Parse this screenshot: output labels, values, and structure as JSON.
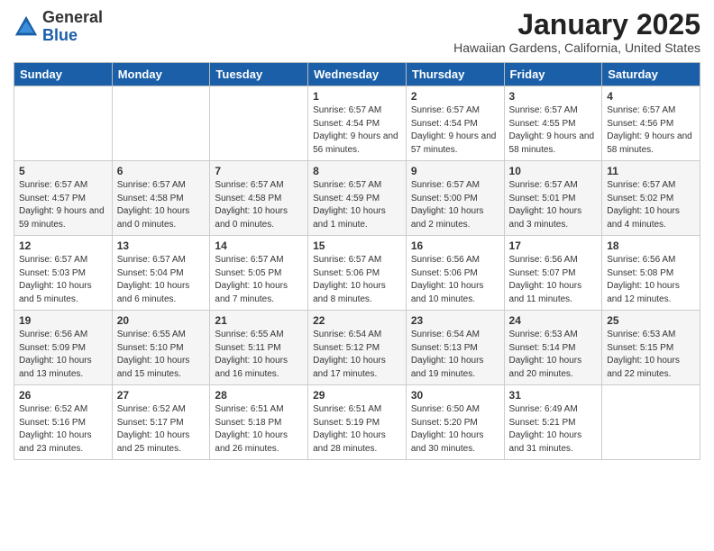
{
  "header": {
    "logo_general": "General",
    "logo_blue": "Blue",
    "title": "January 2025",
    "subtitle": "Hawaiian Gardens, California, United States"
  },
  "calendar": {
    "days_of_week": [
      "Sunday",
      "Monday",
      "Tuesday",
      "Wednesday",
      "Thursday",
      "Friday",
      "Saturday"
    ],
    "weeks": [
      [
        {
          "day": "",
          "info": ""
        },
        {
          "day": "",
          "info": ""
        },
        {
          "day": "",
          "info": ""
        },
        {
          "day": "1",
          "info": "Sunrise: 6:57 AM\nSunset: 4:54 PM\nDaylight: 9 hours and 56 minutes."
        },
        {
          "day": "2",
          "info": "Sunrise: 6:57 AM\nSunset: 4:54 PM\nDaylight: 9 hours and 57 minutes."
        },
        {
          "day": "3",
          "info": "Sunrise: 6:57 AM\nSunset: 4:55 PM\nDaylight: 9 hours and 58 minutes."
        },
        {
          "day": "4",
          "info": "Sunrise: 6:57 AM\nSunset: 4:56 PM\nDaylight: 9 hours and 58 minutes."
        }
      ],
      [
        {
          "day": "5",
          "info": "Sunrise: 6:57 AM\nSunset: 4:57 PM\nDaylight: 9 hours and 59 minutes."
        },
        {
          "day": "6",
          "info": "Sunrise: 6:57 AM\nSunset: 4:58 PM\nDaylight: 10 hours and 0 minutes."
        },
        {
          "day": "7",
          "info": "Sunrise: 6:57 AM\nSunset: 4:58 PM\nDaylight: 10 hours and 0 minutes."
        },
        {
          "day": "8",
          "info": "Sunrise: 6:57 AM\nSunset: 4:59 PM\nDaylight: 10 hours and 1 minute."
        },
        {
          "day": "9",
          "info": "Sunrise: 6:57 AM\nSunset: 5:00 PM\nDaylight: 10 hours and 2 minutes."
        },
        {
          "day": "10",
          "info": "Sunrise: 6:57 AM\nSunset: 5:01 PM\nDaylight: 10 hours and 3 minutes."
        },
        {
          "day": "11",
          "info": "Sunrise: 6:57 AM\nSunset: 5:02 PM\nDaylight: 10 hours and 4 minutes."
        }
      ],
      [
        {
          "day": "12",
          "info": "Sunrise: 6:57 AM\nSunset: 5:03 PM\nDaylight: 10 hours and 5 minutes."
        },
        {
          "day": "13",
          "info": "Sunrise: 6:57 AM\nSunset: 5:04 PM\nDaylight: 10 hours and 6 minutes."
        },
        {
          "day": "14",
          "info": "Sunrise: 6:57 AM\nSunset: 5:05 PM\nDaylight: 10 hours and 7 minutes."
        },
        {
          "day": "15",
          "info": "Sunrise: 6:57 AM\nSunset: 5:06 PM\nDaylight: 10 hours and 8 minutes."
        },
        {
          "day": "16",
          "info": "Sunrise: 6:56 AM\nSunset: 5:06 PM\nDaylight: 10 hours and 10 minutes."
        },
        {
          "day": "17",
          "info": "Sunrise: 6:56 AM\nSunset: 5:07 PM\nDaylight: 10 hours and 11 minutes."
        },
        {
          "day": "18",
          "info": "Sunrise: 6:56 AM\nSunset: 5:08 PM\nDaylight: 10 hours and 12 minutes."
        }
      ],
      [
        {
          "day": "19",
          "info": "Sunrise: 6:56 AM\nSunset: 5:09 PM\nDaylight: 10 hours and 13 minutes."
        },
        {
          "day": "20",
          "info": "Sunrise: 6:55 AM\nSunset: 5:10 PM\nDaylight: 10 hours and 15 minutes."
        },
        {
          "day": "21",
          "info": "Sunrise: 6:55 AM\nSunset: 5:11 PM\nDaylight: 10 hours and 16 minutes."
        },
        {
          "day": "22",
          "info": "Sunrise: 6:54 AM\nSunset: 5:12 PM\nDaylight: 10 hours and 17 minutes."
        },
        {
          "day": "23",
          "info": "Sunrise: 6:54 AM\nSunset: 5:13 PM\nDaylight: 10 hours and 19 minutes."
        },
        {
          "day": "24",
          "info": "Sunrise: 6:53 AM\nSunset: 5:14 PM\nDaylight: 10 hours and 20 minutes."
        },
        {
          "day": "25",
          "info": "Sunrise: 6:53 AM\nSunset: 5:15 PM\nDaylight: 10 hours and 22 minutes."
        }
      ],
      [
        {
          "day": "26",
          "info": "Sunrise: 6:52 AM\nSunset: 5:16 PM\nDaylight: 10 hours and 23 minutes."
        },
        {
          "day": "27",
          "info": "Sunrise: 6:52 AM\nSunset: 5:17 PM\nDaylight: 10 hours and 25 minutes."
        },
        {
          "day": "28",
          "info": "Sunrise: 6:51 AM\nSunset: 5:18 PM\nDaylight: 10 hours and 26 minutes."
        },
        {
          "day": "29",
          "info": "Sunrise: 6:51 AM\nSunset: 5:19 PM\nDaylight: 10 hours and 28 minutes."
        },
        {
          "day": "30",
          "info": "Sunrise: 6:50 AM\nSunset: 5:20 PM\nDaylight: 10 hours and 30 minutes."
        },
        {
          "day": "31",
          "info": "Sunrise: 6:49 AM\nSunset: 5:21 PM\nDaylight: 10 hours and 31 minutes."
        },
        {
          "day": "",
          "info": ""
        }
      ]
    ]
  }
}
